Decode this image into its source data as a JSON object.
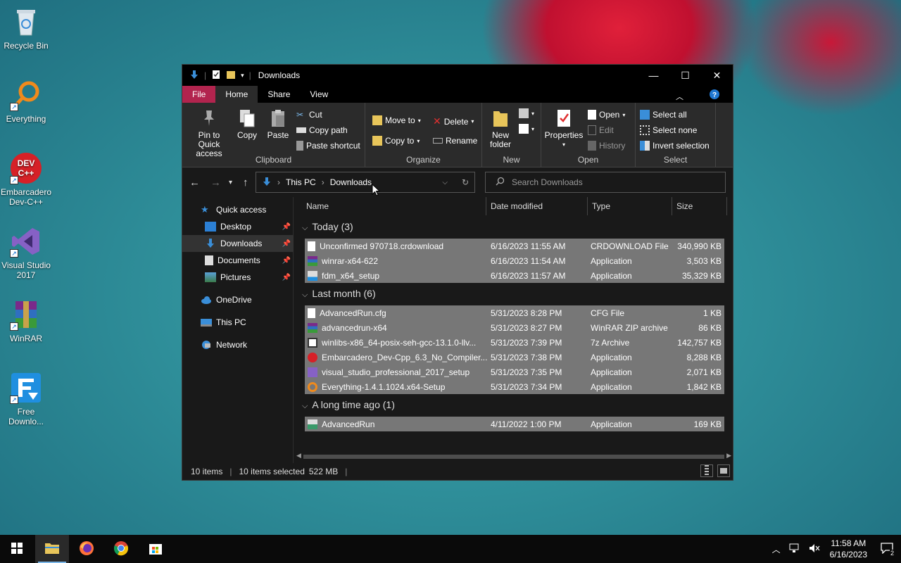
{
  "desktop": {
    "icons": [
      {
        "label": "Recycle Bin",
        "icon": "recycle-bin-icon"
      },
      {
        "label": "Everything",
        "icon": "everything-icon"
      },
      {
        "label": "Embarcadero Dev-C++",
        "icon": "devcpp-icon"
      },
      {
        "label": "Visual Studio 2017",
        "icon": "visual-studio-icon"
      },
      {
        "label": "WinRAR",
        "icon": "winrar-icon"
      },
      {
        "label": "Free Downlo...",
        "icon": "free-download-manager-icon"
      }
    ]
  },
  "window": {
    "title": "Downloads",
    "tabs": {
      "file": "File",
      "home": "Home",
      "share": "Share",
      "view": "View"
    },
    "ribbon": {
      "clipboard": {
        "label": "Clipboard",
        "pin": "Pin to Quick access",
        "copy": "Copy",
        "paste": "Paste",
        "cut": "Cut",
        "copy_path": "Copy path",
        "paste_shortcut": "Paste shortcut"
      },
      "organize": {
        "label": "Organize",
        "move_to": "Move to",
        "copy_to": "Copy to",
        "delete": "Delete",
        "rename": "Rename"
      },
      "new": {
        "label": "New",
        "new_folder": "New folder"
      },
      "open": {
        "label": "Open",
        "properties": "Properties",
        "open": "Open",
        "edit": "Edit",
        "history": "History"
      },
      "select": {
        "label": "Select",
        "select_all": "Select all",
        "select_none": "Select none",
        "invert": "Invert selection"
      }
    },
    "address": {
      "crumbs": [
        "This PC",
        "Downloads"
      ]
    },
    "search": {
      "placeholder": "Search Downloads"
    },
    "nav": {
      "quick_access": "Quick access",
      "desktop": "Desktop",
      "downloads": "Downloads",
      "documents": "Documents",
      "pictures": "Pictures",
      "onedrive": "OneDrive",
      "this_pc": "This PC",
      "network": "Network"
    },
    "columns": {
      "name": "Name",
      "date": "Date modified",
      "type": "Type",
      "size": "Size"
    },
    "groups": [
      {
        "label": "Today (3)",
        "files": [
          {
            "name": "Unconfirmed 970718.crdownload",
            "date": "6/16/2023 11:55 AM",
            "type": "CRDOWNLOAD File",
            "size": "340,990 KB",
            "icon": "blank-file-icon"
          },
          {
            "name": "winrar-x64-622",
            "date": "6/16/2023 11:54 AM",
            "type": "Application",
            "size": "3,503 KB",
            "icon": "winrar-app-icon"
          },
          {
            "name": "fdm_x64_setup",
            "date": "6/16/2023 11:57 AM",
            "type": "Application",
            "size": "35,329 KB",
            "icon": "installer-icon"
          }
        ]
      },
      {
        "label": "Last month (6)",
        "files": [
          {
            "name": "AdvancedRun.cfg",
            "date": "5/31/2023 8:28 PM",
            "type": "CFG File",
            "size": "1 KB",
            "icon": "blank-file-icon"
          },
          {
            "name": "advancedrun-x64",
            "date": "5/31/2023 8:27 PM",
            "type": "WinRAR ZIP archive",
            "size": "86 KB",
            "icon": "zip-archive-icon"
          },
          {
            "name": "winlibs-x86_64-posix-seh-gcc-13.1.0-llv...",
            "date": "5/31/2023 7:39 PM",
            "type": "7z Archive",
            "size": "142,757 KB",
            "icon": "7z-archive-icon"
          },
          {
            "name": "Embarcadero_Dev-Cpp_6.3_No_Compiler...",
            "date": "5/31/2023 7:38 PM",
            "type": "Application",
            "size": "8,288 KB",
            "icon": "devcpp-app-icon"
          },
          {
            "name": "visual_studio_professional_2017_setup",
            "date": "5/31/2023 7:35 PM",
            "type": "Application",
            "size": "2,071 KB",
            "icon": "visual-studio-app-icon"
          },
          {
            "name": "Everything-1.4.1.1024.x64-Setup",
            "date": "5/31/2023 7:34 PM",
            "type": "Application",
            "size": "1,842 KB",
            "icon": "everything-app-icon"
          }
        ]
      },
      {
        "label": "A long time ago (1)",
        "files": [
          {
            "name": "AdvancedRun",
            "date": "4/11/2022 1:00 PM",
            "type": "Application",
            "size": "169 KB",
            "icon": "advancedrun-app-icon"
          }
        ]
      }
    ],
    "status": {
      "items": "10 items",
      "selected": "10 items selected",
      "size": "522 MB"
    }
  },
  "taskbar": {
    "time": "11:58 AM",
    "date": "6/16/2023",
    "notifications": "2",
    "apps": [
      "file-explorer-icon",
      "firefox-icon",
      "chrome-icon",
      "store-icon"
    ]
  },
  "colors": {
    "file_tab": "#b2244e",
    "selection": "#777777",
    "accent": "#7ab6e8"
  }
}
